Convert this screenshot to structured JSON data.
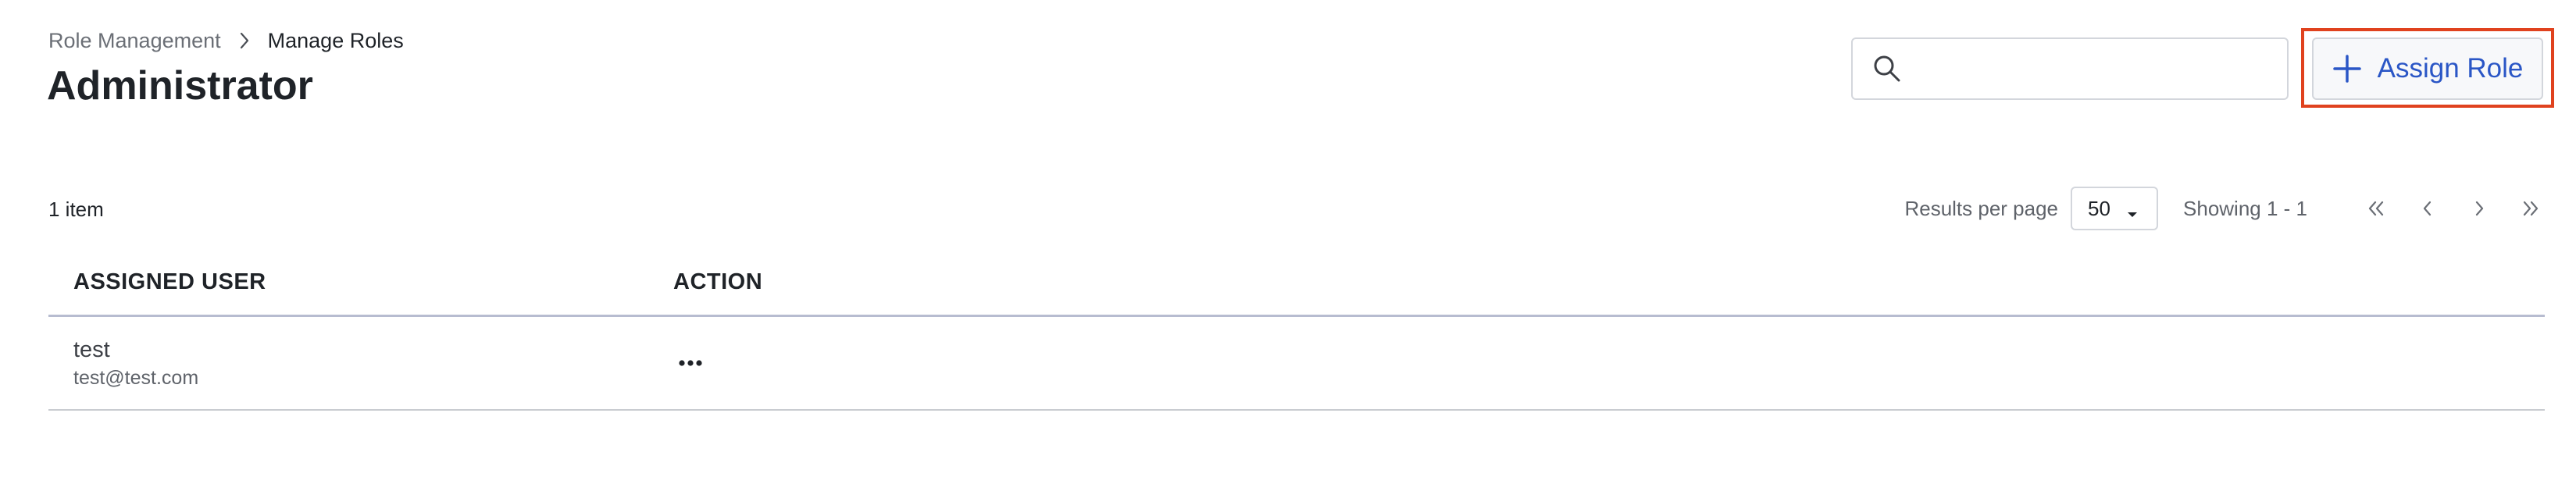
{
  "breadcrumb": {
    "parent": "Role Management",
    "current": "Manage Roles"
  },
  "page": {
    "title": "Administrator"
  },
  "search": {
    "value": "",
    "placeholder": ""
  },
  "actions": {
    "assign_role_label": "Assign Role"
  },
  "list": {
    "item_count": "1 item",
    "results_per_page_label": "Results per page",
    "results_per_page_value": "50",
    "showing": "Showing 1 - 1"
  },
  "table": {
    "columns": [
      "ASSIGNED USER",
      "ACTION"
    ],
    "rows": [
      {
        "name": "test",
        "email": "test@test.com"
      }
    ]
  },
  "icons": {
    "breadcrumb_separator": "chevron-right-icon",
    "search": "search-icon",
    "assign": "plus-icon",
    "select_caret": "caret-down-icon",
    "pager": [
      "double-chevron-left-icon",
      "chevron-left-icon",
      "chevron-right-icon",
      "double-chevron-right-icon"
    ],
    "row_action": "more-horizontal-icon"
  },
  "colors": {
    "accent": "#2a56c6",
    "highlight": "#e0421e",
    "header_divider": "#b7bcd0"
  }
}
